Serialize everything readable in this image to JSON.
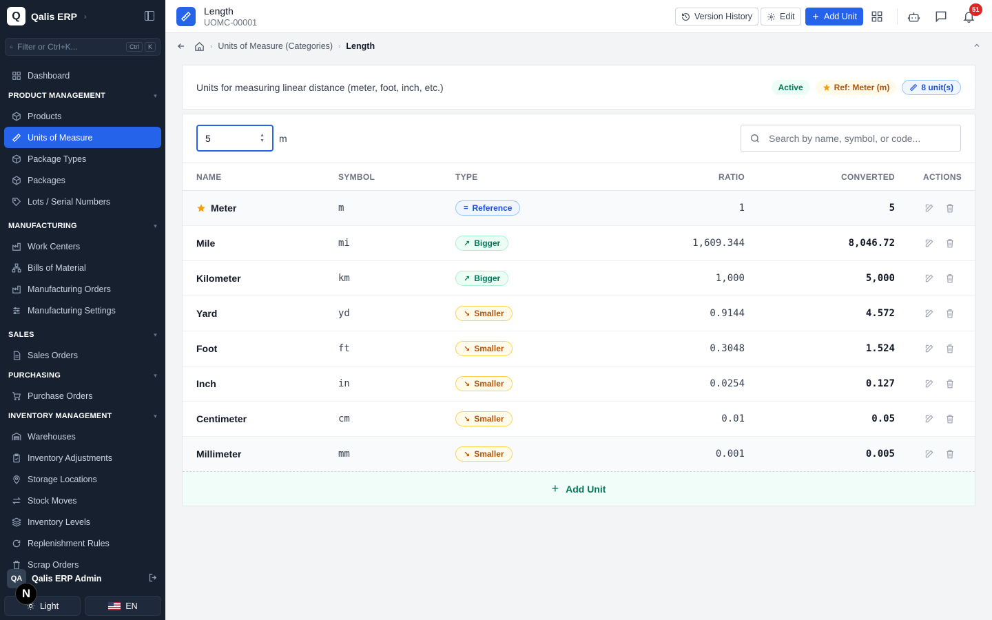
{
  "app": {
    "logo_letter": "Q",
    "name": "Qalis ERP"
  },
  "sidebar": {
    "filter_placeholder": "Filter or Ctrl+K...",
    "kbd_ctrl": "Ctrl",
    "kbd_k": "K",
    "dashboard": "Dashboard",
    "sections": {
      "product": "PRODUCT MANAGEMENT",
      "manufacturing": "MANUFACTURING",
      "sales": "SALES",
      "purchasing": "PURCHASING",
      "inventory": "INVENTORY MANAGEMENT"
    },
    "items": {
      "products": "Products",
      "uom": "Units of Measure",
      "package_types": "Package Types",
      "packages": "Packages",
      "lots": "Lots / Serial Numbers",
      "work_centers": "Work Centers",
      "bom": "Bills of Material",
      "mfg_orders": "Manufacturing Orders",
      "mfg_settings": "Manufacturing Settings",
      "sales_orders": "Sales Orders",
      "purchase_orders": "Purchase Orders",
      "warehouses": "Warehouses",
      "inv_adjust": "Inventory Adjustments",
      "storage": "Storage Locations",
      "stock_moves": "Stock Moves",
      "inv_levels": "Inventory Levels",
      "replenish": "Replenishment Rules",
      "scrap": "Scrap Orders"
    },
    "user_initials": "QA",
    "user_name": "Qalis ERP Admin",
    "n_badge": "N",
    "theme_label": "Light",
    "lang_label": "EN"
  },
  "header": {
    "title": "Length",
    "code": "UOMC-00001",
    "version_history": "Version History",
    "edit": "Edit",
    "add_unit": "Add Unit",
    "notif_count": "51"
  },
  "breadcrumb": {
    "parent": "Units of Measure (Categories)",
    "current": "Length"
  },
  "category": {
    "description": "Units for measuring linear distance (meter, foot, inch, etc.)",
    "status": "Active",
    "ref": "Ref: Meter (m)",
    "unit_count": "8 unit(s)"
  },
  "converter": {
    "quantity": "5",
    "unit": "m",
    "search_placeholder": "Search by name, symbol, or code..."
  },
  "table": {
    "headers": {
      "name": "NAME",
      "symbol": "SYMBOL",
      "type": "TYPE",
      "ratio": "RATIO",
      "converted": "CONVERTED",
      "actions": "ACTIONS"
    },
    "rows": [
      {
        "name": "Meter",
        "symbol": "m",
        "type": "Reference",
        "ratio": "1",
        "converted": "5"
      },
      {
        "name": "Mile",
        "symbol": "mi",
        "type": "Bigger",
        "ratio": "1,609.344",
        "converted": "8,046.72"
      },
      {
        "name": "Kilometer",
        "symbol": "km",
        "type": "Bigger",
        "ratio": "1,000",
        "converted": "5,000"
      },
      {
        "name": "Yard",
        "symbol": "yd",
        "type": "Smaller",
        "ratio": "0.9144",
        "converted": "4.572"
      },
      {
        "name": "Foot",
        "symbol": "ft",
        "type": "Smaller",
        "ratio": "0.3048",
        "converted": "1.524"
      },
      {
        "name": "Inch",
        "symbol": "in",
        "type": "Smaller",
        "ratio": "0.0254",
        "converted": "0.127"
      },
      {
        "name": "Centimeter",
        "symbol": "cm",
        "type": "Smaller",
        "ratio": "0.01",
        "converted": "0.05"
      },
      {
        "name": "Millimeter",
        "symbol": "mm",
        "type": "Smaller",
        "ratio": "0.001",
        "converted": "0.005"
      }
    ],
    "add_unit": "Add Unit"
  },
  "colors": {
    "accent": "#2563eb",
    "sidebar_bg": "#16202f",
    "success": "#047857",
    "warning": "#b45309",
    "danger": "#dc2626"
  }
}
